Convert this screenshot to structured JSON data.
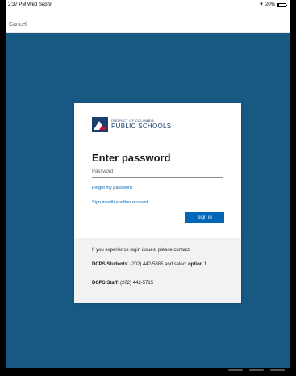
{
  "status": {
    "time": "2:37 PM  Wed Sep 9",
    "battery": "20%",
    "battery_level": 0.2
  },
  "nav": {
    "cancel_label": "Cancel"
  },
  "logo": {
    "line1": "DISTRICT OF COLUMBIA",
    "line2": "PUBLIC SCHOOLS"
  },
  "login": {
    "title": "Enter password",
    "password_placeholder": "Password",
    "password_value": "",
    "forgot_link": "Forgot my password",
    "other_account_link": "Sign in with another account",
    "signin_label": "Sign in"
  },
  "help": {
    "intro": "If you experience login issues, please contact:",
    "students_label": "DCPS Students",
    "students_text": ": (202) 442-5885 and select ",
    "students_option": "option 1",
    "staff_label": "DCPS Staff",
    "staff_text": ": (202) 442-5715"
  },
  "colors": {
    "background": "#175983",
    "accent": "#0067b8"
  }
}
